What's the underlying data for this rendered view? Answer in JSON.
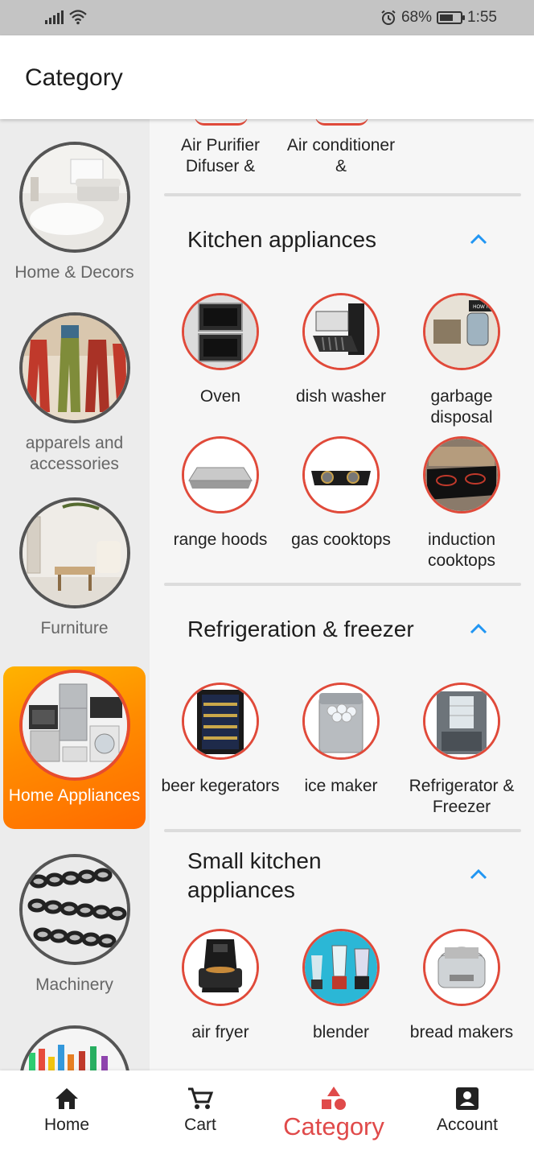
{
  "status_bar": {
    "battery": "68%",
    "time": "1:55"
  },
  "app_bar": {
    "title": "Category"
  },
  "sidebar": {
    "items": [
      {
        "label": "Home & Decors",
        "active": false
      },
      {
        "label": "apparels and accessories",
        "active": false
      },
      {
        "label": "Furniture",
        "active": false
      },
      {
        "label": "Home Appliances",
        "active": true
      },
      {
        "label": "Machinery",
        "active": false
      },
      {
        "label": "",
        "active": false
      }
    ]
  },
  "partial_items": [
    {
      "label": "Air Purifier Difuser &"
    },
    {
      "label": "Air conditioner &"
    }
  ],
  "sections": [
    {
      "title": "Kitchen appliances",
      "items": [
        {
          "label": "Oven"
        },
        {
          "label": "dish washer"
        },
        {
          "label": "garbage disposal"
        },
        {
          "label": "range hoods"
        },
        {
          "label": "gas cooktops"
        },
        {
          "label": "induction cooktops"
        }
      ]
    },
    {
      "title": "Refrigeration & freezer",
      "items": [
        {
          "label": "beer kegerators"
        },
        {
          "label": "ice maker"
        },
        {
          "label": "Refrigerator & Freezer"
        }
      ]
    },
    {
      "title": "Small kitchen appliances",
      "items": [
        {
          "label": "air fryer"
        },
        {
          "label": "blender"
        },
        {
          "label": "bread makers"
        }
      ]
    }
  ],
  "bottom_nav": {
    "items": [
      {
        "label": "Home",
        "icon": "home-icon"
      },
      {
        "label": "Cart",
        "icon": "cart-icon"
      },
      {
        "label": "Category",
        "icon": "category-icon",
        "active": true
      },
      {
        "label": "Account",
        "icon": "account-icon"
      }
    ]
  },
  "colors": {
    "accent": "#e04a4a",
    "chevron": "#2196f3",
    "active_gradient_start": "#ffb300",
    "active_gradient_end": "#ff6a00"
  }
}
